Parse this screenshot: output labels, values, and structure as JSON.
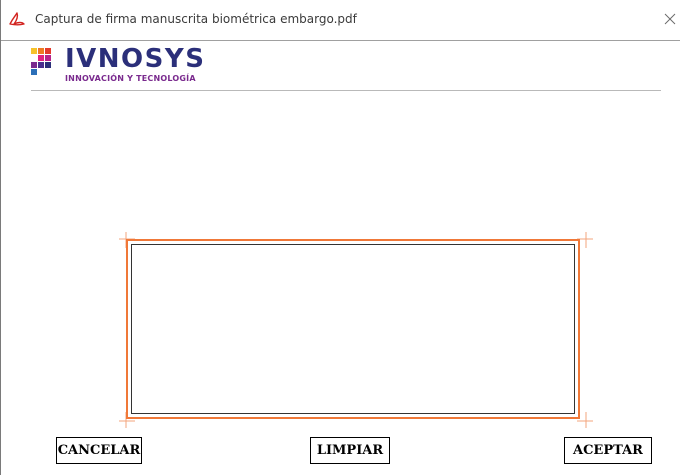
{
  "window": {
    "title": "Captura de firma manuscrita biométrica embargo.pdf",
    "icons": {
      "app": "acrobat-icon",
      "close": "close-icon"
    }
  },
  "logo": {
    "name": "IVNOSYS",
    "tagline": "INNOVACIÓN Y TECNOLOGÍA"
  },
  "signature_area": {
    "icon": "signature-pad"
  },
  "buttons": {
    "cancel": "CANCELAR",
    "clear": "LIMPIAR",
    "accept": "ACEPTAR"
  },
  "colors": {
    "brand_blue": "#2b2f7a",
    "brand_purple": "#7a2a8e",
    "signature_border": "#f07838"
  }
}
